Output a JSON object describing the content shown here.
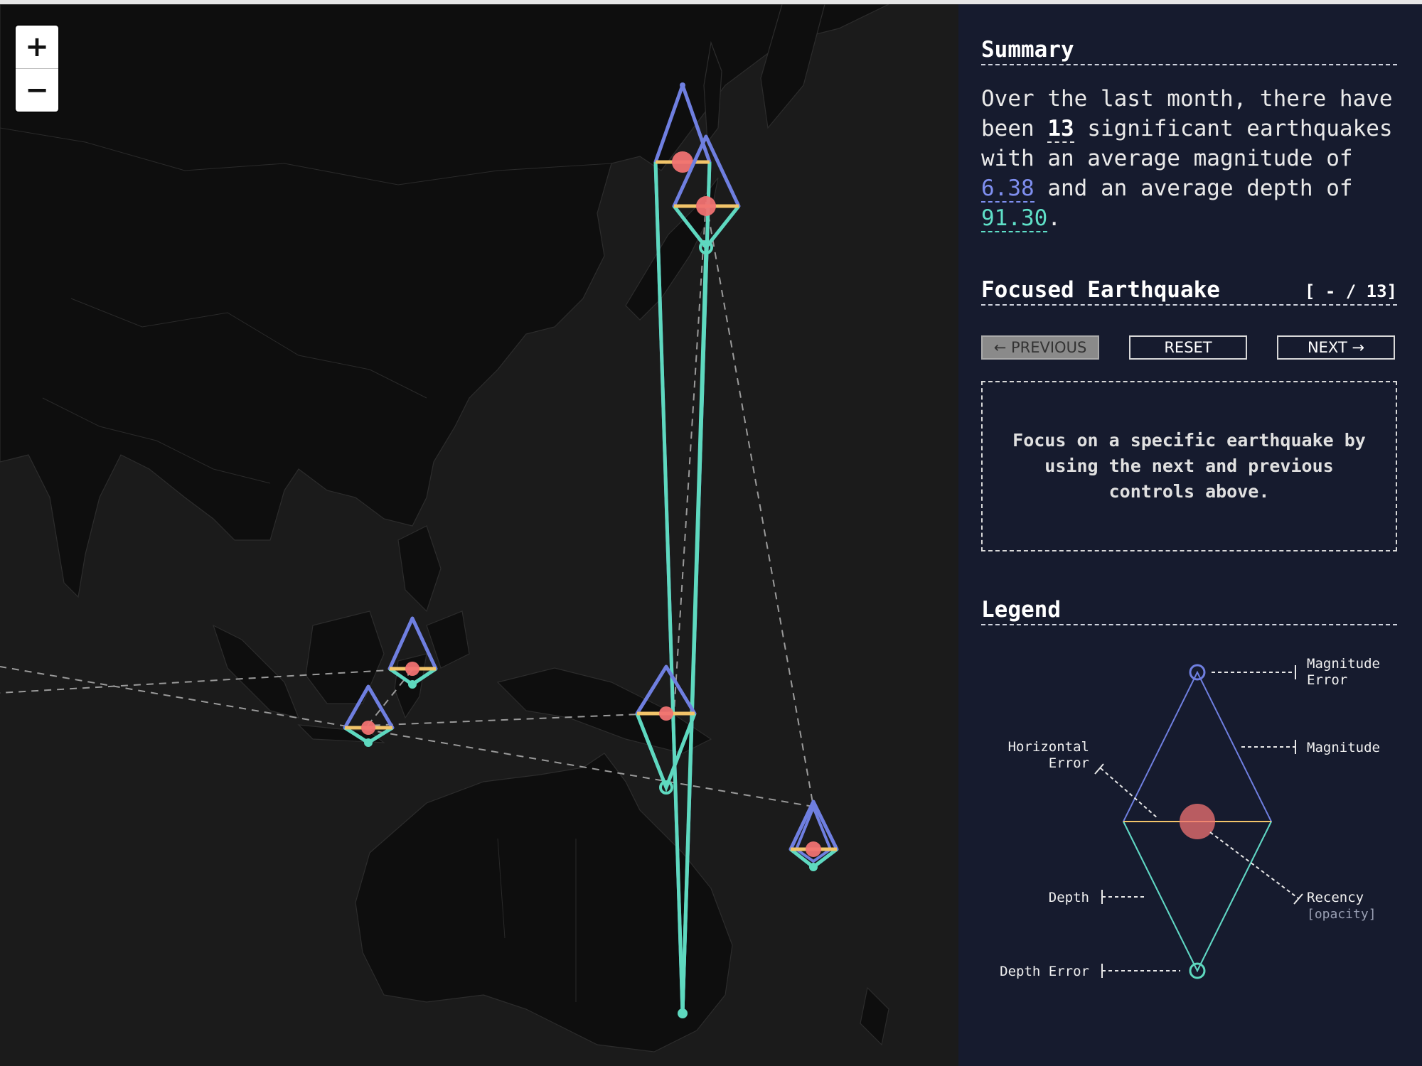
{
  "map": {
    "zoom_in_label": "+",
    "zoom_out_label": "−",
    "colors": {
      "magnitude": "#6f7fe0",
      "depth": "#5ed9bf",
      "horizontal": "#f2c46a",
      "recency": "#f07272",
      "connector": "#9a9a9a"
    }
  },
  "summary": {
    "title": "Summary",
    "text_1": "Over the last month, there have been ",
    "count": "13",
    "text_2": " significant earthquakes with an average magnitude of ",
    "avg_magnitude": "6.38",
    "text_3": " and an average depth of ",
    "avg_depth": "91.30",
    "text_4": "."
  },
  "focused": {
    "title": "Focused Earthquake",
    "counter": "[ - / 13]",
    "prev_label": "← PREVIOUS",
    "reset_label": "RESET",
    "next_label": "NEXT →",
    "message": "Focus on a specific earthquake by using the next and previous controls above."
  },
  "legend": {
    "title": "Legend",
    "magnitude_error_1": "Magnitude",
    "magnitude_error_2": "Error",
    "magnitude": "Magnitude",
    "horizontal_error_1": "Horizontal",
    "horizontal_error_2": "Error",
    "depth": "Depth",
    "recency": "Recency",
    "recency_sub": "[opacity]",
    "depth_error": "Depth Error"
  }
}
